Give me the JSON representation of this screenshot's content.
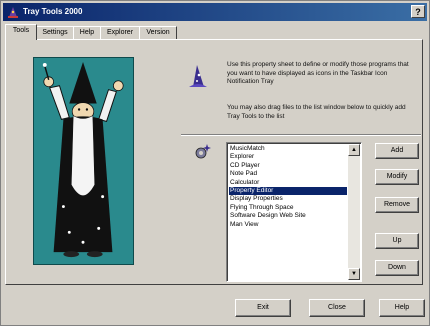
{
  "window": {
    "title": "Tray Tools 2000",
    "help_button_label": "?"
  },
  "tabs": [
    {
      "label": "Tools"
    },
    {
      "label": "Settings"
    },
    {
      "label": "Help"
    },
    {
      "label": "Explorer"
    },
    {
      "label": "Version"
    }
  ],
  "description": {
    "paragraph1": "Use this property sheet to define or modify those programs that you want to have displayed as icons in the Taskbar Icon Notification Tray",
    "paragraph2": "You may also drag files to the list window below to quickly add Tray Tools to the list"
  },
  "program_list": {
    "items": [
      "MusicMatch",
      "Explorer",
      "CD Player",
      "Note Pad",
      "Calculator",
      "Property Editor",
      "Display Properties",
      "Flying Through Space",
      "Software Design Web Site",
      "Man View"
    ],
    "selected_index": 5
  },
  "side_buttons": {
    "add": "Add",
    "modify": "Modify",
    "remove": "Remove",
    "up": "Up",
    "down": "Down"
  },
  "bottom_buttons": {
    "exit": "Exit",
    "close": "Close",
    "help": "Help"
  },
  "icons": {
    "app": "tray-wizard-icon",
    "description": "wizard-hat-icon",
    "list": "gear-sparkle-icon"
  },
  "colors": {
    "titlebar_start": "#0a246a",
    "titlebar_end": "#3a6ea5",
    "wizard_background": "#2a8a8d",
    "selection": "#0a246a"
  }
}
